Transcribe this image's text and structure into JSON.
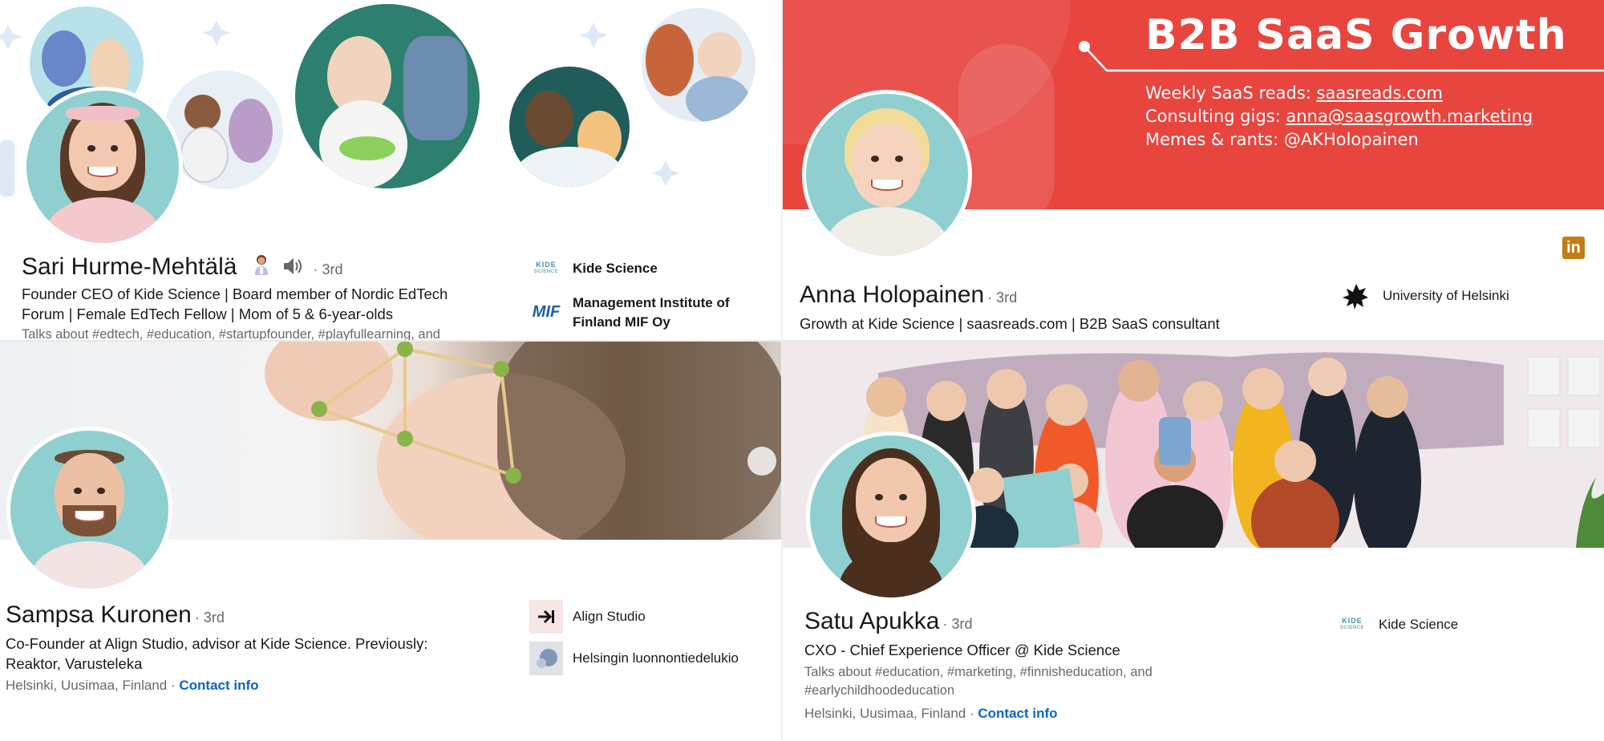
{
  "profiles": [
    {
      "name": "Sari Hurme-Mehtälä",
      "degree": "· 3rd",
      "headline": "Founder CEO of Kide Science | Board member of Nordic EdTech Forum | Female EdTech Fellow | Mom of 5 & 6-year-olds",
      "talks": "Talks about #edtech, #education, #startupfounder, #playfullearning, and",
      "orgs": [
        {
          "name": "Kide Science",
          "logo": "kide-science-logo"
        },
        {
          "name": "Management Institute of Finland MIF Oy",
          "logo": "mif-logo"
        }
      ],
      "icons": [
        "scientist-emoji-icon",
        "speaker-icon"
      ]
    },
    {
      "name": "Anna Holopainen",
      "degree": "· 3rd",
      "headline": "Growth at Kide Science | saasreads.com | B2B SaaS consultant",
      "orgs": [
        {
          "name": "University of Helsinki",
          "logo": "university-of-helsinki-logo"
        }
      ],
      "banner": {
        "title": "B2B SaaS Growth",
        "line1_label": "Weekly SaaS reads: ",
        "line1_link": "saasreads.com",
        "line2_label": "Consulting gigs: ",
        "line2_link": "anna@saasgrowth.marketing",
        "line3": "Memes & rants: @AKHolopainen",
        "color": "#e8453f"
      },
      "linkedin_badge": "in"
    },
    {
      "name": "Sampsa Kuronen",
      "degree": "· 3rd",
      "headline": "Co-Founder at Align Studio, advisor at Kide Science. Previously: Reaktor, Varusteleka",
      "location": "Helsinki, Uusimaa, Finland · ",
      "contact": "Contact info",
      "orgs": [
        {
          "name": "Align Studio",
          "logo": "align-studio-logo"
        },
        {
          "name": "Helsingin luonnontiedelukio",
          "logo": "helsingin-luonnontiedelukio-logo"
        }
      ]
    },
    {
      "name": "Satu Apukka",
      "degree": "· 3rd",
      "headline": "CXO - Chief Experience Officer @ Kide Science",
      "talks": "Talks about #education, #marketing, #finnisheducation, and #earlychildhoodeducation",
      "location": "Helsinki, Uusimaa, Finland · ",
      "contact": "Contact info",
      "orgs": [
        {
          "name": "Kide Science",
          "logo": "kide-science-logo"
        }
      ]
    }
  ],
  "kide_logo_text": {
    "top": "KIDE",
    "bottom": "SCIENCE"
  },
  "mif_logo_text": "MIF",
  "colors": {
    "link": "#0a66c2",
    "avatar_bg": "#8fcfcf",
    "banner_red": "#e8453f",
    "linkedin_gold": "#c37d16"
  }
}
